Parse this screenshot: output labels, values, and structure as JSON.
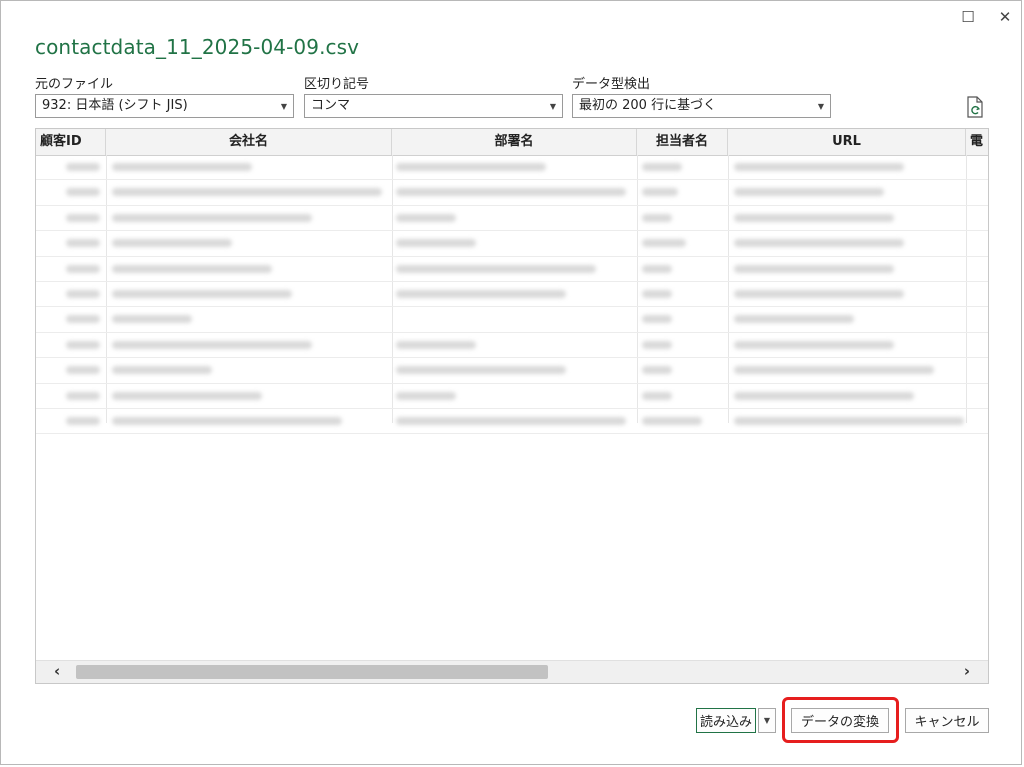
{
  "window": {
    "title": "contactdata_11_2025-04-09.csv",
    "maximize_glyph": "☐",
    "close_glyph": "✕"
  },
  "controls": {
    "file_origin": {
      "label": "元のファイル",
      "value": "932: 日本語 (シフト JIS)"
    },
    "delimiter": {
      "label": "区切り記号",
      "value": "コンマ"
    },
    "type_detection": {
      "label": "データ型検出",
      "value": "最初の 200 行に基づく"
    },
    "refresh_icon": "refresh-file-icon",
    "chevron_glyph": "▼"
  },
  "grid": {
    "columns": [
      "顧客ID",
      "会社名",
      "部署名",
      "担当者名",
      "URL",
      "電"
    ],
    "row_count": 11,
    "scroll_left_glyph": "‹",
    "scroll_right_glyph": "›"
  },
  "footer": {
    "load_label": "読み込み",
    "load_dropdown_glyph": "▼",
    "transform_label": "データの変換",
    "cancel_label": "キャンセル"
  },
  "colors": {
    "accent_green": "#217346",
    "highlight_red": "#e61e1e"
  }
}
